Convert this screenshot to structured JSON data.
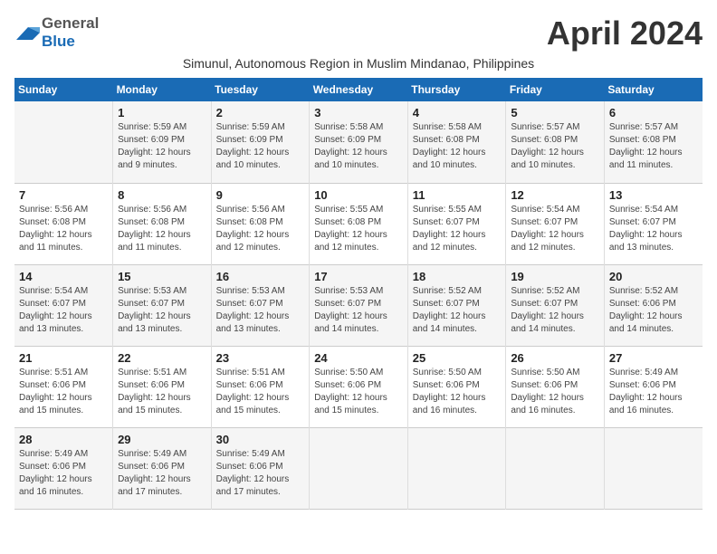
{
  "header": {
    "logo_general": "General",
    "logo_blue": "Blue",
    "month_title": "April 2024",
    "subtitle": "Simunul, Autonomous Region in Muslim Mindanao, Philippines"
  },
  "days_of_week": [
    "Sunday",
    "Monday",
    "Tuesday",
    "Wednesday",
    "Thursday",
    "Friday",
    "Saturday"
  ],
  "weeks": [
    [
      {
        "day": "",
        "info": ""
      },
      {
        "day": "1",
        "info": "Sunrise: 5:59 AM\nSunset: 6:09 PM\nDaylight: 12 hours\nand 9 minutes."
      },
      {
        "day": "2",
        "info": "Sunrise: 5:59 AM\nSunset: 6:09 PM\nDaylight: 12 hours\nand 10 minutes."
      },
      {
        "day": "3",
        "info": "Sunrise: 5:58 AM\nSunset: 6:09 PM\nDaylight: 12 hours\nand 10 minutes."
      },
      {
        "day": "4",
        "info": "Sunrise: 5:58 AM\nSunset: 6:08 PM\nDaylight: 12 hours\nand 10 minutes."
      },
      {
        "day": "5",
        "info": "Sunrise: 5:57 AM\nSunset: 6:08 PM\nDaylight: 12 hours\nand 10 minutes."
      },
      {
        "day": "6",
        "info": "Sunrise: 5:57 AM\nSunset: 6:08 PM\nDaylight: 12 hours\nand 11 minutes."
      }
    ],
    [
      {
        "day": "7",
        "info": "Sunrise: 5:56 AM\nSunset: 6:08 PM\nDaylight: 12 hours\nand 11 minutes."
      },
      {
        "day": "8",
        "info": "Sunrise: 5:56 AM\nSunset: 6:08 PM\nDaylight: 12 hours\nand 11 minutes."
      },
      {
        "day": "9",
        "info": "Sunrise: 5:56 AM\nSunset: 6:08 PM\nDaylight: 12 hours\nand 12 minutes."
      },
      {
        "day": "10",
        "info": "Sunrise: 5:55 AM\nSunset: 6:08 PM\nDaylight: 12 hours\nand 12 minutes."
      },
      {
        "day": "11",
        "info": "Sunrise: 5:55 AM\nSunset: 6:07 PM\nDaylight: 12 hours\nand 12 minutes."
      },
      {
        "day": "12",
        "info": "Sunrise: 5:54 AM\nSunset: 6:07 PM\nDaylight: 12 hours\nand 12 minutes."
      },
      {
        "day": "13",
        "info": "Sunrise: 5:54 AM\nSunset: 6:07 PM\nDaylight: 12 hours\nand 13 minutes."
      }
    ],
    [
      {
        "day": "14",
        "info": "Sunrise: 5:54 AM\nSunset: 6:07 PM\nDaylight: 12 hours\nand 13 minutes."
      },
      {
        "day": "15",
        "info": "Sunrise: 5:53 AM\nSunset: 6:07 PM\nDaylight: 12 hours\nand 13 minutes."
      },
      {
        "day": "16",
        "info": "Sunrise: 5:53 AM\nSunset: 6:07 PM\nDaylight: 12 hours\nand 13 minutes."
      },
      {
        "day": "17",
        "info": "Sunrise: 5:53 AM\nSunset: 6:07 PM\nDaylight: 12 hours\nand 14 minutes."
      },
      {
        "day": "18",
        "info": "Sunrise: 5:52 AM\nSunset: 6:07 PM\nDaylight: 12 hours\nand 14 minutes."
      },
      {
        "day": "19",
        "info": "Sunrise: 5:52 AM\nSunset: 6:07 PM\nDaylight: 12 hours\nand 14 minutes."
      },
      {
        "day": "20",
        "info": "Sunrise: 5:52 AM\nSunset: 6:06 PM\nDaylight: 12 hours\nand 14 minutes."
      }
    ],
    [
      {
        "day": "21",
        "info": "Sunrise: 5:51 AM\nSunset: 6:06 PM\nDaylight: 12 hours\nand 15 minutes."
      },
      {
        "day": "22",
        "info": "Sunrise: 5:51 AM\nSunset: 6:06 PM\nDaylight: 12 hours\nand 15 minutes."
      },
      {
        "day": "23",
        "info": "Sunrise: 5:51 AM\nSunset: 6:06 PM\nDaylight: 12 hours\nand 15 minutes."
      },
      {
        "day": "24",
        "info": "Sunrise: 5:50 AM\nSunset: 6:06 PM\nDaylight: 12 hours\nand 15 minutes."
      },
      {
        "day": "25",
        "info": "Sunrise: 5:50 AM\nSunset: 6:06 PM\nDaylight: 12 hours\nand 16 minutes."
      },
      {
        "day": "26",
        "info": "Sunrise: 5:50 AM\nSunset: 6:06 PM\nDaylight: 12 hours\nand 16 minutes."
      },
      {
        "day": "27",
        "info": "Sunrise: 5:49 AM\nSunset: 6:06 PM\nDaylight: 12 hours\nand 16 minutes."
      }
    ],
    [
      {
        "day": "28",
        "info": "Sunrise: 5:49 AM\nSunset: 6:06 PM\nDaylight: 12 hours\nand 16 minutes."
      },
      {
        "day": "29",
        "info": "Sunrise: 5:49 AM\nSunset: 6:06 PM\nDaylight: 12 hours\nand 17 minutes."
      },
      {
        "day": "30",
        "info": "Sunrise: 5:49 AM\nSunset: 6:06 PM\nDaylight: 12 hours\nand 17 minutes."
      },
      {
        "day": "",
        "info": ""
      },
      {
        "day": "",
        "info": ""
      },
      {
        "day": "",
        "info": ""
      },
      {
        "day": "",
        "info": ""
      }
    ]
  ]
}
